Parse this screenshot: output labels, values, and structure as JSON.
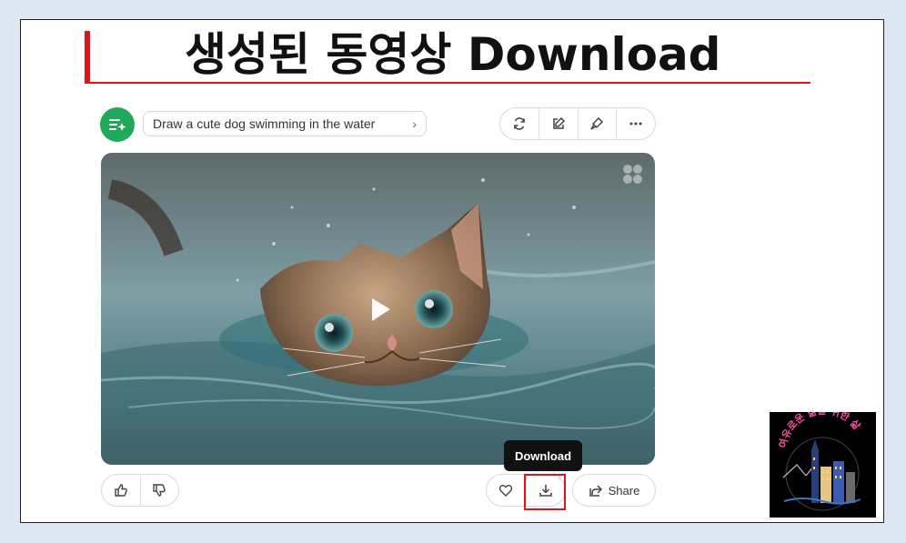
{
  "title": "생성된 동영상 Download",
  "prompt": {
    "avatar_icon": "sparkle-list-icon",
    "text": "Draw a cute dog swimming in the water",
    "chevron": "›"
  },
  "toolbar": {
    "items": [
      {
        "name": "regenerate",
        "icon": "refresh-icon"
      },
      {
        "name": "edit",
        "icon": "edit-icon"
      },
      {
        "name": "brush",
        "icon": "brush-icon"
      },
      {
        "name": "more",
        "icon": "more-icon"
      }
    ]
  },
  "media": {
    "description_icon": "play-icon",
    "corner_icon": "clover-icon"
  },
  "tooltip": {
    "text": "Download"
  },
  "feedback": {
    "like_icon": "thumbs-up-icon",
    "dislike_icon": "thumbs-down-icon"
  },
  "actions": {
    "favorite_icon": "heart-icon",
    "download_icon": "download-icon"
  },
  "share": {
    "label": "Share",
    "icon": "share-icon"
  },
  "logo": {
    "text": "여유로운 삶을 위한 삶"
  },
  "colors": {
    "accent_red": "#e0121b",
    "avatar_green": "#21a85a",
    "logo_pink": "#ff4fa3"
  }
}
